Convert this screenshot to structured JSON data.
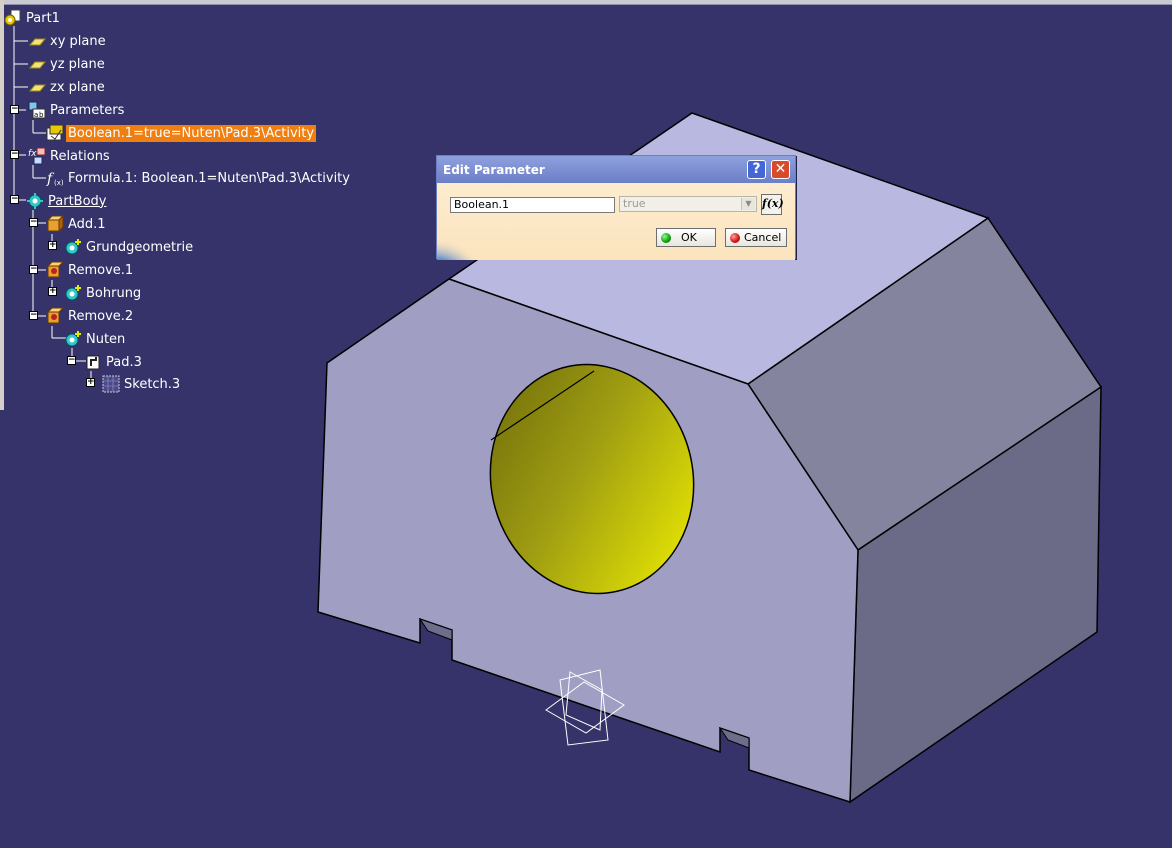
{
  "tree": {
    "items": [
      {
        "label": "Part1",
        "icon": "part-icon"
      },
      {
        "label": "xy plane",
        "icon": "plane-icon"
      },
      {
        "label": "yz plane",
        "icon": "plane-icon"
      },
      {
        "label": "zx plane",
        "icon": "plane-icon"
      },
      {
        "label": "Parameters",
        "icon": "parameters-icon"
      },
      {
        "label": "Boolean.1=true=Nuten\\Pad.3\\Activity",
        "icon": "boolean-parameter-icon",
        "selected": true
      },
      {
        "label": "Relations",
        "icon": "relations-icon"
      },
      {
        "label": "Formula.1: Boolean.1=Nuten\\Pad.3\\Activity",
        "icon": "formula-icon"
      },
      {
        "label": "PartBody",
        "icon": "body-icon"
      },
      {
        "label": "Add.1",
        "icon": "boolean-add-icon"
      },
      {
        "label": "Grundgeometrie",
        "icon": "body-icon"
      },
      {
        "label": "Remove.1",
        "icon": "boolean-remove-icon"
      },
      {
        "label": "Bohrung",
        "icon": "body-icon"
      },
      {
        "label": "Remove.2",
        "icon": "boolean-remove-icon"
      },
      {
        "label": "Nuten",
        "icon": "body-icon"
      },
      {
        "label": "Pad.3",
        "icon": "pad-icon"
      },
      {
        "label": "Sketch.3",
        "icon": "sketch-icon"
      }
    ]
  },
  "dialog": {
    "title": "Edit Parameter",
    "help_label": "?",
    "close_label": "✕",
    "param_name": "Boolean.1",
    "param_value": "true",
    "formula_button": "f(x)",
    "ok_label": "OK",
    "cancel_label": "Cancel"
  },
  "colors": {
    "background": "#35336a",
    "selection": "#f07f12",
    "part_top": "#b9b8e0",
    "part_front": "#a09fc4",
    "part_side": "#6d6c89",
    "hole_yellow": "#e8e800"
  }
}
